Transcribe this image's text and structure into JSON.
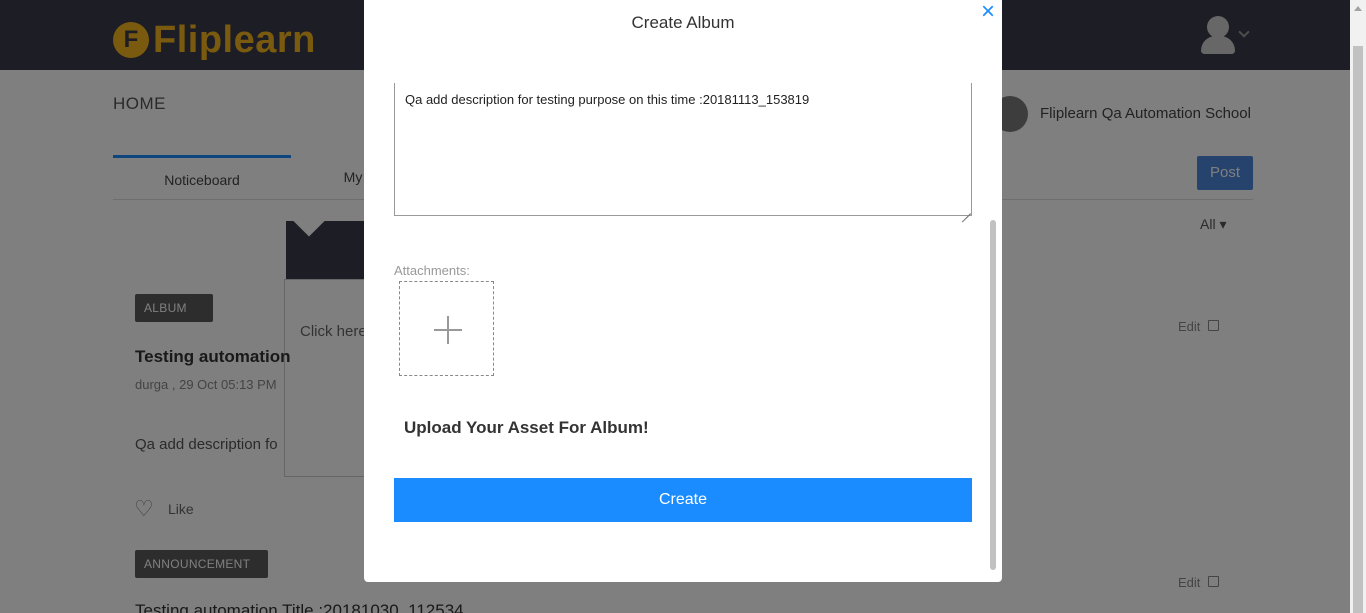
{
  "app": {
    "logo_letter": "F",
    "logo_text": "Fliplearn",
    "brand_color": "#f3b51c",
    "accent_color": "#1a8cff"
  },
  "header": {
    "home_title": "HOME",
    "school_name": "Fliplearn Qa Automation School"
  },
  "tabs": [
    {
      "label": "Noticeboard",
      "active": true
    },
    {
      "label": "My",
      "active": false
    }
  ],
  "actions": {
    "post_label": "Post",
    "filter_label": "All ▾"
  },
  "popover": {
    "text": "Click here to te"
  },
  "feed": {
    "posts": [
      {
        "badge": "ALBUM",
        "title": "Testing automation",
        "meta": "durga , 29 Oct 05:13 PM",
        "description": "Qa add description fo",
        "like_label": "Like",
        "edit_label": "Edit"
      },
      {
        "badge": "ANNOUNCEMENT",
        "title": "Testing automation Title :20181030_112534",
        "edit_label": "Edit"
      }
    ]
  },
  "modal": {
    "title": "Create Album",
    "close_icon": "×",
    "description_value": "Qa add description for testing purpose on this time :20181113_153819",
    "attachments_label": "Attachments:",
    "upload_message": "Upload Your Asset For Album!",
    "create_label": "Create"
  }
}
